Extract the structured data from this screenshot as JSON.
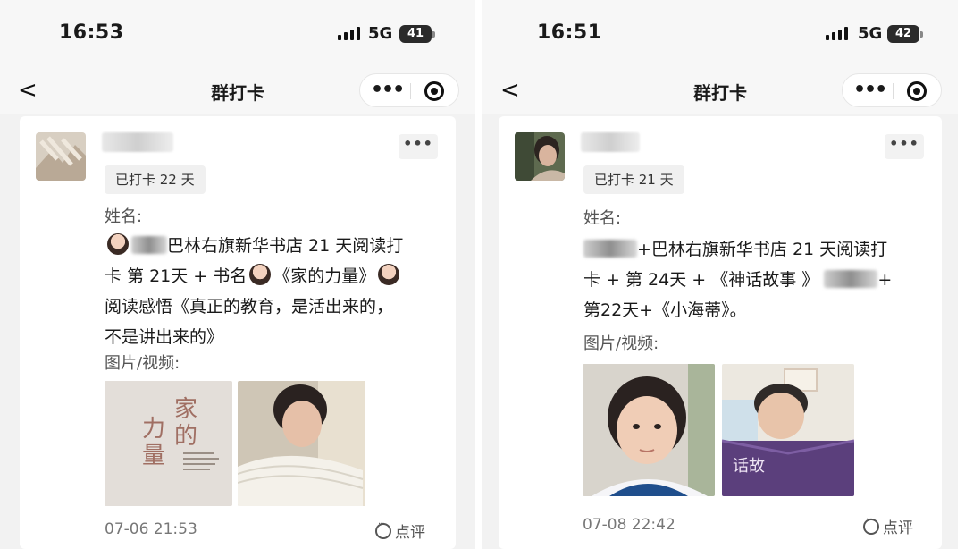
{
  "left": {
    "status": {
      "time": "16:53",
      "network": "5G",
      "battery": "41"
    },
    "nav": {
      "title": "群打卡",
      "back_glyph": "<",
      "more_glyph": "•••"
    },
    "post": {
      "options_glyph": "•••",
      "badge": "已打卡 22 天",
      "name_label": "姓名:",
      "line1_text": "巴林右旗新华书店 21 天阅读打",
      "line2_text": "卡 第 21天 + 书名",
      "line2_book": "《家的力量》",
      "line3": "阅读感悟《真正的教育，是活出来的，",
      "line4": "不是讲出来的》",
      "media_label": "图片/视频:",
      "book_cover_title": "家 的 力 量",
      "timestamp": "07-06 21:53",
      "comment_label": "点评"
    }
  },
  "right": {
    "status": {
      "time": "16:51",
      "network": "5G",
      "battery": "42"
    },
    "nav": {
      "title": "群打卡",
      "back_glyph": "<",
      "more_glyph": "•••"
    },
    "post": {
      "options_glyph": "•••",
      "badge": "已打卡 21 天",
      "name_label": "姓名:",
      "line1_text": "+巴林右旗新华书店 21 天阅读打",
      "line2_text": "卡 + 第 24天 + 《神话故事 》",
      "line2_tail": "+",
      "line3": "第22天+《小海蒂》。",
      "media_label": "图片/视频:",
      "timestamp": "07-08 22:42",
      "comment_label": "点评"
    }
  },
  "colors": {
    "background": "#f2f2f2",
    "card": "#ffffff",
    "badge_bg": "#f0f0f0",
    "muted_text": "#777777"
  },
  "icons": [
    "chevron-left-icon",
    "more-icon",
    "close-circle-icon",
    "signal-icon",
    "battery-icon",
    "comment-icon"
  ]
}
